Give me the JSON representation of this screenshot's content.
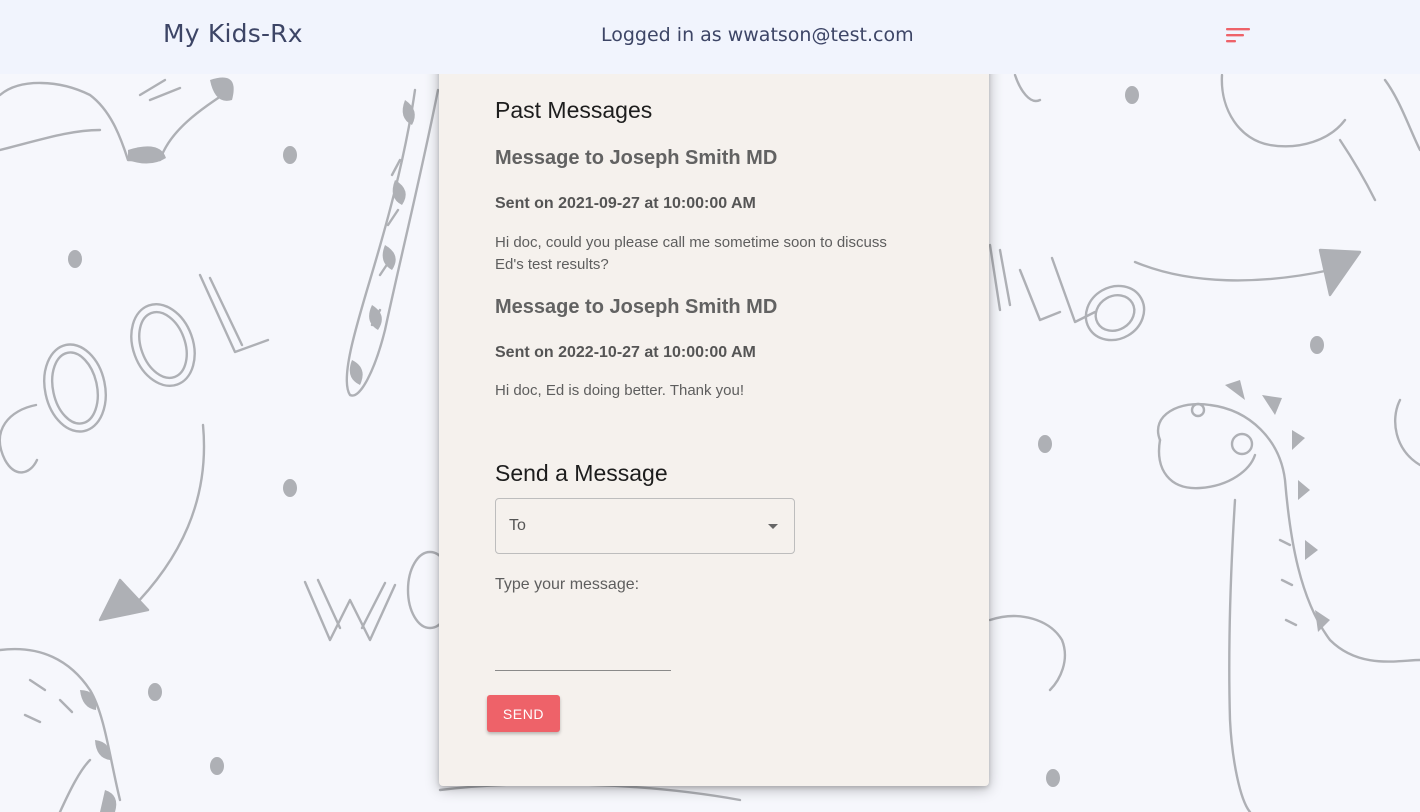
{
  "header": {
    "brand": "My Kids-Rx",
    "logged_in": "Logged in as wwatson@test.com",
    "menu_icon": "menu-icon",
    "accent_color": "#ee6269"
  },
  "background": {
    "doodle_words": [
      "COOL",
      "HELLO",
      "WO"
    ],
    "color": "#a9abb0"
  },
  "past_messages": {
    "heading": "Past Messages",
    "items": [
      {
        "title": "Message to Joseph Smith MD",
        "sent": "Sent on 2021-09-27 at 10:00:00 AM",
        "body": "Hi doc, could you please call me sometime soon to discuss Ed's test results?"
      },
      {
        "title": "Message to Joseph Smith MD",
        "sent": "Sent on 2022-10-27 at 10:00:00 AM",
        "body": "Hi doc, Ed is doing better. Thank you!"
      }
    ]
  },
  "send_message": {
    "heading": "Send a Message",
    "to_label": "To",
    "type_label": "Type your message:",
    "message_value": "",
    "send_label": "SEND"
  }
}
